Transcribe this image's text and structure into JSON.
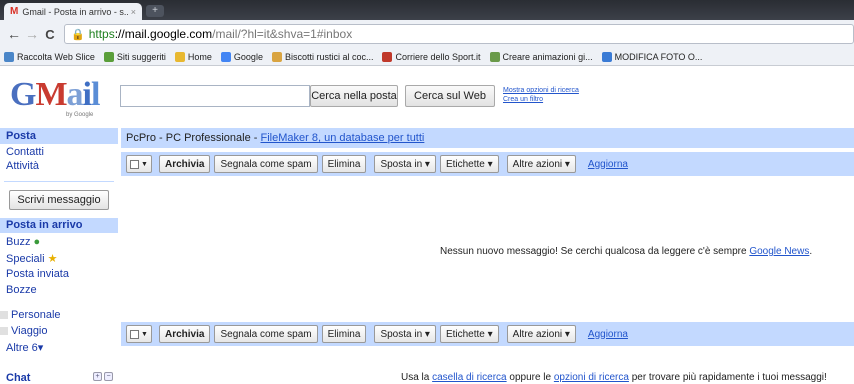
{
  "browser": {
    "tab_title": "Gmail - Posta in arrivo - s...",
    "tab_close": "×",
    "new_tab": "+",
    "url_scheme": "https",
    "url_host": "://mail.google.com",
    "url_path": "/mail/?hl=it&shva=1#inbox",
    "nav_back": "←",
    "nav_forward": "→",
    "reload": "C"
  },
  "bookmarks": [
    {
      "label": "Raccolta Web Slice",
      "color": "#4a86c8"
    },
    {
      "label": "Siti suggeriti",
      "color": "#5a9e3a"
    },
    {
      "label": "Home",
      "color": "#e8b830"
    },
    {
      "label": "Google",
      "color": "#4285f4"
    },
    {
      "label": "Biscotti rustici al coc...",
      "color": "#d9a441"
    },
    {
      "label": "Corriere dello Sport.it",
      "color": "#c0392b"
    },
    {
      "label": "Creare animazioni gi...",
      "color": "#6a9a4a"
    },
    {
      "label": "MODIFICA FOTO O...",
      "color": "#3a7bd5"
    }
  ],
  "header": {
    "logo": {
      "G": "G",
      "M": "M",
      "a": "a",
      "i": "i",
      "l": "l"
    },
    "by_google": "by Google",
    "search_value": "",
    "search_mail_label": "Cerca nella posta",
    "search_web_label": "Cerca sul Web",
    "search_options_label": "Mostra opzioni di ricerca",
    "create_filter_label": "Crea un filtro"
  },
  "sidebar": {
    "posta": "Posta",
    "contatti": "Contatti",
    "attivita": "Attività",
    "compose": "Scrivi messaggio",
    "inbox": "Posta in arrivo",
    "buzz": "Buzz",
    "speciali": "Speciali",
    "sent": "Posta inviata",
    "drafts": "Bozze",
    "labels": [
      "Personale",
      "Viaggio"
    ],
    "more": "Altre 6▾",
    "chat": "Chat"
  },
  "main": {
    "clip_source": "PcPro - PC Professionale - ",
    "clip_link": "FileMaker 8, un database per tutti",
    "actions": {
      "archive": "Archivia",
      "spam": "Segnala come spam",
      "delete": "Elimina",
      "move": "Sposta in ▾",
      "labels": "Etichette ▾",
      "more": "Altre azioni ▾",
      "refresh": "Aggiorna"
    },
    "empty_text": "Nessun nuovo messaggio! Se cerchi qualcosa da leggere c'è sempre ",
    "empty_link": "Google News",
    "empty_end": ".",
    "footer_pre": "Usa la ",
    "footer_link1": "casella di ricerca",
    "footer_mid": " oppure le ",
    "footer_link2": "opzioni di ricerca",
    "footer_post": " per trovare più rapidamente i tuoi messaggi!"
  }
}
